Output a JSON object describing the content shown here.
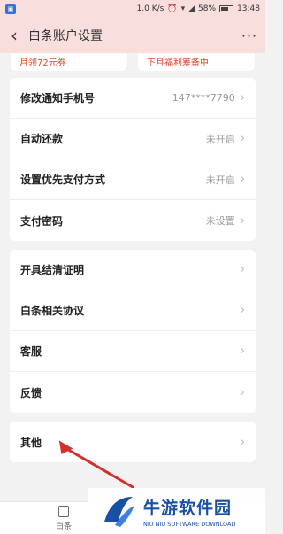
{
  "status_bar": {
    "speed": "1.0 K/s",
    "battery": "58%",
    "time": "13:48",
    "app_badge": "▣"
  },
  "nav": {
    "title": "白条账户设置",
    "back_icon": "chevron-left-icon",
    "more_icon": "more-dots-icon"
  },
  "promos": [
    {
      "text": "月领72元券"
    },
    {
      "text": "下月福利筹备中"
    }
  ],
  "group1": [
    {
      "label": "修改通知手机号",
      "value": "147****7790"
    },
    {
      "label": "自动还款",
      "value": "未开启"
    },
    {
      "label": "设置优先支付方式",
      "value": "未开启"
    },
    {
      "label": "支付密码",
      "value": "未设置"
    }
  ],
  "group2": [
    {
      "label": "开具结清证明"
    },
    {
      "label": "白条相关协议"
    },
    {
      "label": "客服"
    },
    {
      "label": "反馈"
    }
  ],
  "group3": [
    {
      "label": "其他"
    }
  ],
  "bottom_tab": {
    "label": "白条"
  },
  "watermark": {
    "cn": "牛游软件园",
    "en": "NIU NIU SOFTWARE DOWNLOAD"
  },
  "colors": {
    "header_bg": "#f9dede",
    "promo_text": "#e2452f",
    "arrow": "#d32f2f",
    "watermark": "#1a4fa8"
  }
}
